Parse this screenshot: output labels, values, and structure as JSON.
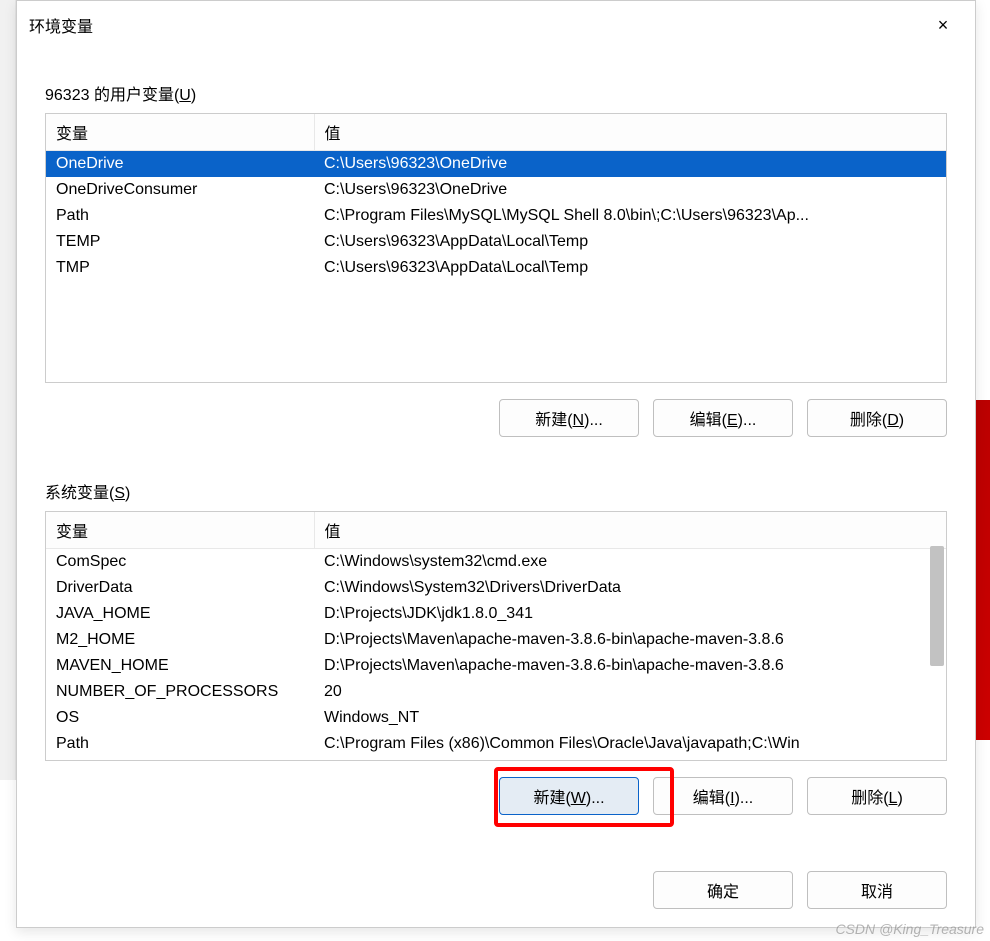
{
  "window": {
    "title": "环境变量",
    "close_label": "×"
  },
  "user_section": {
    "label_prefix": "96323 的用户变量(",
    "label_accel": "U",
    "label_suffix": ")",
    "columns": {
      "var": "变量",
      "value": "值"
    },
    "rows": [
      {
        "name": "OneDrive",
        "value": "C:\\Users\\96323\\OneDrive",
        "selected": true
      },
      {
        "name": "OneDriveConsumer",
        "value": "C:\\Users\\96323\\OneDrive",
        "selected": false
      },
      {
        "name": "Path",
        "value": "C:\\Program Files\\MySQL\\MySQL Shell 8.0\\bin\\;C:\\Users\\96323\\Ap...",
        "selected": false
      },
      {
        "name": "TEMP",
        "value": "C:\\Users\\96323\\AppData\\Local\\Temp",
        "selected": false
      },
      {
        "name": "TMP",
        "value": "C:\\Users\\96323\\AppData\\Local\\Temp",
        "selected": false
      }
    ],
    "buttons": {
      "new_pre": "新建(",
      "new_accel": "N",
      "new_post": ")...",
      "edit_pre": "编辑(",
      "edit_accel": "E",
      "edit_post": ")...",
      "del_pre": "删除(",
      "del_accel": "D",
      "del_post": ")"
    }
  },
  "system_section": {
    "label_prefix": "系统变量(",
    "label_accel": "S",
    "label_suffix": ")",
    "columns": {
      "var": "变量",
      "value": "值"
    },
    "rows": [
      {
        "name": "ComSpec",
        "value": "C:\\Windows\\system32\\cmd.exe"
      },
      {
        "name": "DriverData",
        "value": "C:\\Windows\\System32\\Drivers\\DriverData"
      },
      {
        "name": "JAVA_HOME",
        "value": "D:\\Projects\\JDK\\jdk1.8.0_341"
      },
      {
        "name": "M2_HOME",
        "value": "D:\\Projects\\Maven\\apache-maven-3.8.6-bin\\apache-maven-3.8.6"
      },
      {
        "name": "MAVEN_HOME",
        "value": "D:\\Projects\\Maven\\apache-maven-3.8.6-bin\\apache-maven-3.8.6"
      },
      {
        "name": "NUMBER_OF_PROCESSORS",
        "value": "20"
      },
      {
        "name": "OS",
        "value": "Windows_NT"
      },
      {
        "name": "Path",
        "value": "C:\\Program Files (x86)\\Common Files\\Oracle\\Java\\javapath;C:\\Win"
      }
    ],
    "buttons": {
      "new_pre": "新建(",
      "new_accel": "W",
      "new_post": ")...",
      "edit_pre": "编辑(",
      "edit_accel": "I",
      "edit_post": ")...",
      "del_pre": "删除(",
      "del_accel": "L",
      "del_post": ")"
    }
  },
  "dialog_buttons": {
    "ok": "确定",
    "cancel": "取消"
  },
  "watermark": "CSDN @King_Treasure"
}
